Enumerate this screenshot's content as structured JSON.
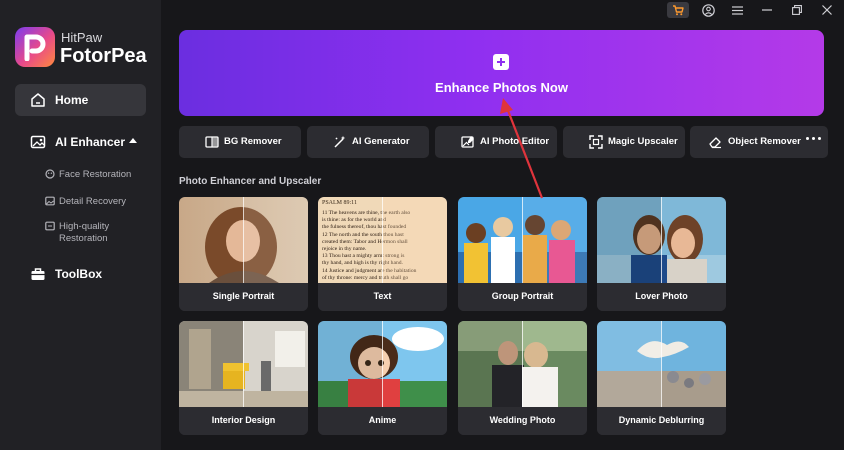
{
  "app": {
    "brand_top": "HitPaw",
    "brand_main": "FotorPea"
  },
  "sidebar": {
    "home": "Home",
    "ai_enhancer": "AI Enhancer",
    "sub_items": [
      {
        "label": "Face Restoration"
      },
      {
        "label": "Detail Recovery"
      },
      {
        "label_line1": "High-quality",
        "label_line2": "Restoration"
      }
    ],
    "toolbox": "ToolBox"
  },
  "hero": {
    "label": "Enhance Photos Now"
  },
  "tools": [
    {
      "label": "BG Remover",
      "icon": "bg-remover-icon"
    },
    {
      "label": "AI Generator",
      "icon": "magic-wand-icon"
    },
    {
      "label": "AI Photo Editor",
      "icon": "photo-edit-icon"
    },
    {
      "label": "Magic Upscaler",
      "icon": "upscale-icon"
    },
    {
      "label": "Object Remover",
      "icon": "eraser-icon"
    }
  ],
  "section": {
    "title": "Photo Enhancer and Upscaler"
  },
  "cards": [
    {
      "label": "Single Portrait"
    },
    {
      "label": "Text"
    },
    {
      "label": "Group Portrait"
    },
    {
      "label": "Lover Photo"
    },
    {
      "label": "Interior Design"
    },
    {
      "label": "Anime"
    },
    {
      "label": "Wedding Photo"
    },
    {
      "label": "Dynamic Deblurring"
    }
  ],
  "text_sample": {
    "heading": "PSALM 89:11",
    "lines": [
      "11 The heavens are thine, the earth also",
      "is thine: as for the world and",
      "the fulness thereof, thou hast founded",
      "12 The north and the south thou hast",
      "created them: Tabor and Hermon shall",
      "rejoice in thy name.",
      "13 Thou hast a mighty arm: strong is",
      "thy hand, and high is thy right hand.",
      "14 Justice and judgment are the habitation",
      "of thy throne: mercy and truth shall go"
    ]
  },
  "colors": {
    "accent": "#8f2ff0",
    "sidebar_bg": "#212125",
    "main_bg": "#17171a",
    "arrow": "#e0343c"
  }
}
